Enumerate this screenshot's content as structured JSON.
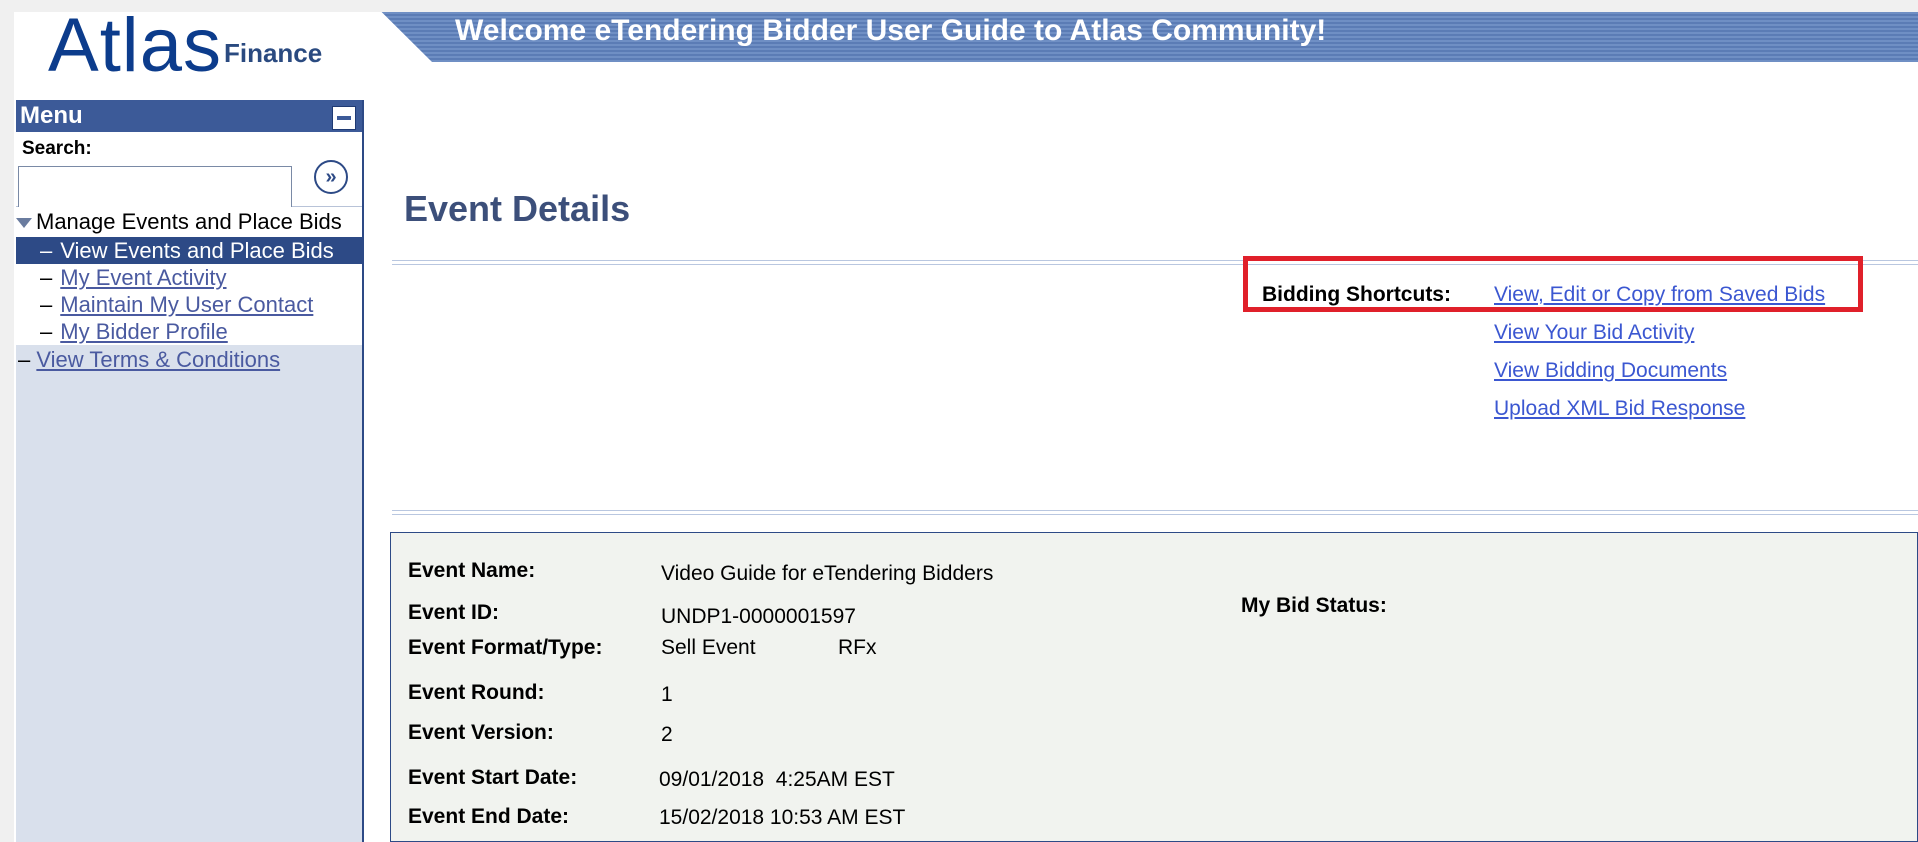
{
  "header": {
    "logo_main": "Atlas",
    "logo_sub": "Finance",
    "banner_title": "Welcome eTendering Bidder User Guide to Atlas Community!"
  },
  "sidebar": {
    "menu_title": "Menu",
    "search_label": "Search:",
    "search_value": "",
    "search_go_icon": "double-chevron-right-icon",
    "group_label": "Manage Events and Place Bids",
    "items": [
      {
        "label": "View Events and Place Bids",
        "active": true
      },
      {
        "label": "My Event Activity",
        "active": false
      },
      {
        "label": "Maintain My User Contact",
        "active": false
      },
      {
        "label": "My Bidder Profile",
        "active": false
      }
    ],
    "root_link": "View Terms & Conditions"
  },
  "main": {
    "page_title": "Event Details",
    "bidding_shortcuts_label": "Bidding Shortcuts:",
    "shortcuts": [
      "View, Edit or Copy from Saved Bids",
      "View Your Bid Activity",
      "View Bidding Documents",
      "Upload XML Bid Response"
    ]
  },
  "details": {
    "event_name_label": "Event Name:",
    "event_name": "Video Guide for eTendering Bidders",
    "event_id_label": "Event ID:",
    "event_id": "UNDP1-0000001597",
    "format_type_label": "Event Format/Type:",
    "format": "Sell Event",
    "type": "RFx",
    "round_label": "Event Round:",
    "round": "1",
    "version_label": "Event Version:",
    "version": "2",
    "start_label": "Event Start Date:",
    "start": "09/01/2018  4:25AM EST",
    "end_label": "Event End Date:",
    "end": "15/02/2018 10:53 AM EST",
    "bid_status_label": "My Bid Status:"
  },
  "colors": {
    "banner": "#5b7cb5",
    "menu_header": "#3c5a98",
    "highlight_box": "#e0202a",
    "link": "#3b57d1"
  }
}
